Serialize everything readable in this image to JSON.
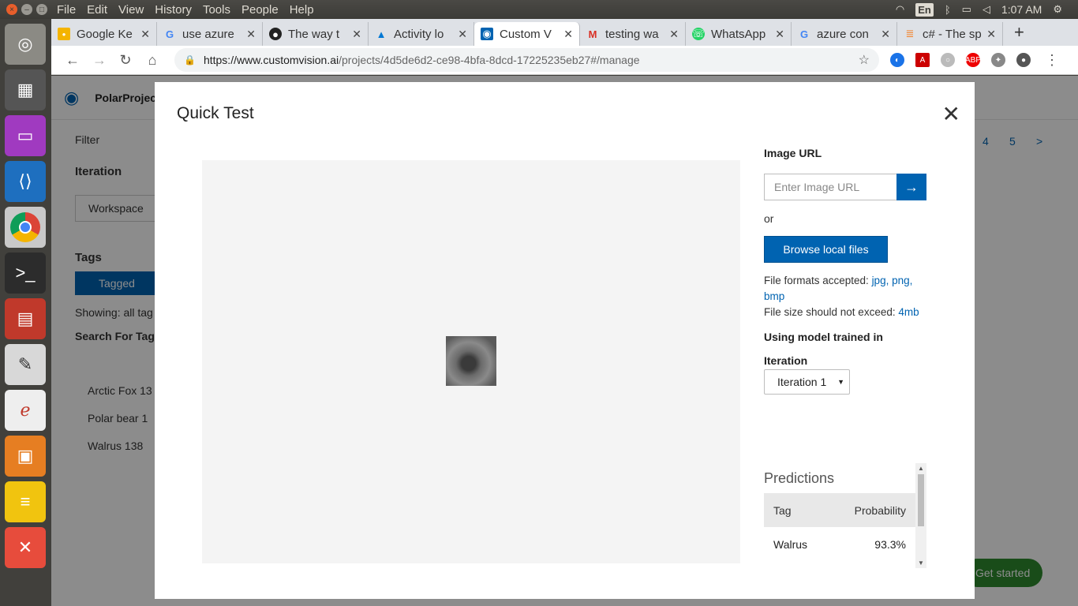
{
  "os": {
    "menu": [
      "File",
      "Edit",
      "View",
      "History",
      "Tools",
      "People",
      "Help"
    ],
    "keyboard_layout": "En",
    "clock": "1:07 AM"
  },
  "browser": {
    "tabs": [
      {
        "title": "Google Ke",
        "icon": "keep-icon",
        "color": "#f4b400"
      },
      {
        "title": "use azure",
        "icon": "google-icon",
        "color": "#4285f4"
      },
      {
        "title": "The way t",
        "icon": "github-icon",
        "color": "#222222"
      },
      {
        "title": "Activity lo",
        "icon": "azure-icon",
        "color": "#0078d4"
      },
      {
        "title": "Custom V",
        "icon": "customvision-icon",
        "color": "#0063b1"
      },
      {
        "title": "testing wa",
        "icon": "gmail-icon",
        "color": "#d93025"
      },
      {
        "title": "WhatsApp",
        "icon": "whatsapp-icon",
        "color": "#25d366"
      },
      {
        "title": "azure con",
        "icon": "google-icon",
        "color": "#4285f4"
      },
      {
        "title": "c# - The sp",
        "icon": "stackoverflow-icon",
        "color": "#f48024"
      }
    ],
    "url_host": "https://www.customvision.ai",
    "url_path": "/projects/4d5de6d2-ce98-4bfa-8dcd-17225235eb27#/manage"
  },
  "background_page": {
    "project_name": "PolarProjec",
    "filter": "Filter",
    "iteration_heading": "Iteration",
    "workspace": "Workspace",
    "tags_heading": "Tags",
    "tagged": "Tagged",
    "showing": "Showing: all tag",
    "search_label": "Search For Tags:",
    "tags": [
      "Arctic Fox  13",
      "Polar bear  1",
      "Walrus  138"
    ],
    "pages": [
      "4",
      "5",
      ">"
    ],
    "get_started": "Get started"
  },
  "modal": {
    "title": "Quick Test",
    "image_url_label": "Image URL",
    "image_url_placeholder": "Enter Image URL",
    "or_text": "or",
    "browse_label": "Browse local files",
    "formats_prefix": "File formats accepted: ",
    "formats": [
      "jpg,",
      "png,",
      "bmp"
    ],
    "size_prefix": "File size should not exceed: ",
    "size_value": "4mb",
    "model_label": "Using model trained in",
    "iteration_label": "Iteration",
    "iteration_selected": "Iteration 1",
    "predictions_title": "Predictions",
    "predictions_headers": [
      "Tag",
      "Probability"
    ],
    "predictions": [
      {
        "tag": "Walrus",
        "probability": "93.3%"
      }
    ]
  }
}
